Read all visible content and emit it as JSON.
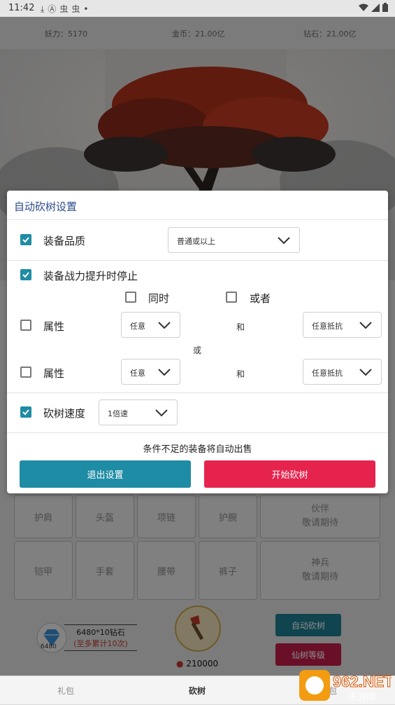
{
  "status_bar": {
    "time": "11:42",
    "left_icons": [
      "download-icon",
      "a-icon",
      "bug-icon",
      "bug-icon",
      "dot-icon"
    ],
    "right_icons": [
      "wifi-icon",
      "signal-icon",
      "battery-icon"
    ]
  },
  "top_info": {
    "power": "妖力：5170",
    "gold": "金币：21.00亿",
    "diamond": "钻石：21.00亿"
  },
  "equipment": {
    "row1": [
      "护肩",
      "头盔",
      "项链",
      "护腕"
    ],
    "row1_extra": [
      "伙伴",
      "敬请期待"
    ],
    "row2": [
      "铠甲",
      "手套",
      "腰带",
      "裤子"
    ],
    "row2_extra": [
      "神兵",
      "敬请期待"
    ]
  },
  "bottom_area": {
    "gem_price": "6480*10钻石",
    "gem_note": "(至多累计10次)",
    "gem_badge": "6480",
    "axe_count": "210000",
    "auto_chop": "自动砍树",
    "tree_level": "仙树等级"
  },
  "nav": {
    "tabs": [
      "礼包",
      "砍树",
      "背包"
    ],
    "active": "砍树"
  },
  "watermark": {
    "text": "962.NET",
    "sub": "乐游网"
  },
  "dialog": {
    "title": "自动砍树设置",
    "quality_label": "装备品质",
    "quality_checked": true,
    "quality_value": "普通或以上",
    "stop_label": "装备战力提升时停止",
    "stop_checked": true,
    "same_time": "同时",
    "or_label": "或者",
    "attr1_label": "属性",
    "attr1_value": "任意",
    "and1": "和",
    "resist1_value": "任意抵抗",
    "or_between": "或",
    "attr2_label": "属性",
    "attr2_value": "任意",
    "and2": "和",
    "resist2_value": "任意抵抗",
    "speed_label": "砍树速度",
    "speed_checked": true,
    "speed_value": "1倍速",
    "note": "条件不足的装备将自动出售",
    "exit_button": "退出设置",
    "start_button": "开始砍树"
  },
  "colors": {
    "teal": "#1f8ca5",
    "crimson": "#e5234d",
    "title_blue": "#2c4c8c",
    "game_teal": "#1e7e93",
    "game_red": "#c41d4a"
  }
}
